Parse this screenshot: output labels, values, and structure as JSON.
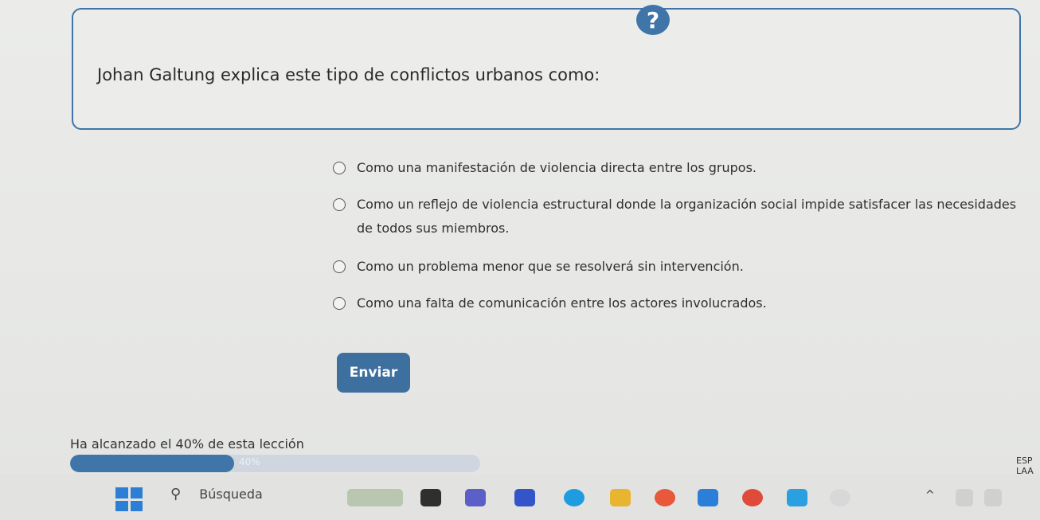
{
  "question": {
    "badge": "?",
    "text": "Johan Galtung explica este tipo de conflictos urbanos como:"
  },
  "options": [
    {
      "label": "Como una manifestación de violencia directa entre los grupos."
    },
    {
      "label": "Como un reflejo de violencia estructural donde la organización social impide satisfacer las necesidades de todos sus miembros."
    },
    {
      "label": "Como un problema menor que se resolverá sin intervención."
    },
    {
      "label": "Como una falta de comunicación entre los actores involucrados."
    }
  ],
  "submit_label": "Enviar",
  "progress": {
    "label": "Ha alcanzado el 40% de esta lección",
    "percent_text": "40%",
    "value": 40
  },
  "taskbar": {
    "search_label": "Búsqueda",
    "lang_top": "ESP",
    "lang_bottom": "LAA"
  },
  "colors": {
    "accent": "#3f75a8",
    "button": "#3d6f9f"
  }
}
